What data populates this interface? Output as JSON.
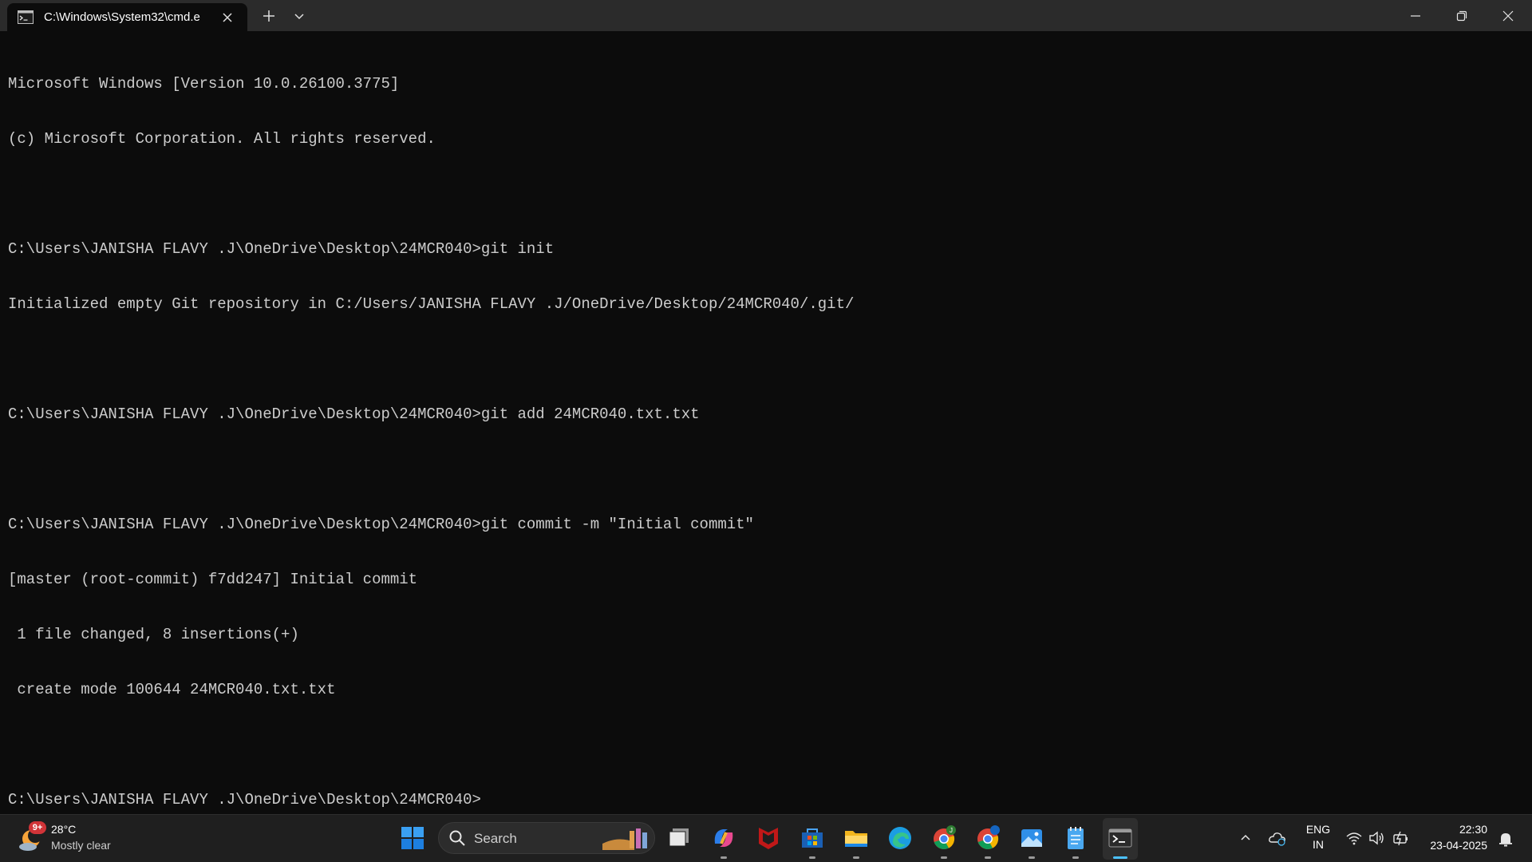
{
  "window": {
    "tab_title": "C:\\Windows\\System32\\cmd.e",
    "icons": {
      "tab": "cmd-icon",
      "close_tab": "close-icon",
      "new_tab": "plus-icon",
      "dropdown": "chevron-down-icon",
      "minimize": "minimize-icon",
      "restore": "restore-icon",
      "close": "close-icon"
    }
  },
  "console": {
    "lines": [
      "Microsoft Windows [Version 10.0.26100.3775]",
      "(c) Microsoft Corporation. All rights reserved.",
      "",
      "C:\\Users\\JANISHA FLAVY .J\\OneDrive\\Desktop\\24MCR040>git init",
      "Initialized empty Git repository in C:/Users/JANISHA FLAVY .J/OneDrive/Desktop/24MCR040/.git/",
      "",
      "C:\\Users\\JANISHA FLAVY .J\\OneDrive\\Desktop\\24MCR040>git add 24MCR040.txt.txt",
      "",
      "C:\\Users\\JANISHA FLAVY .J\\OneDrive\\Desktop\\24MCR040>git commit -m \"Initial commit\"",
      "[master (root-commit) f7dd247] Initial commit",
      " 1 file changed, 8 insertions(+)",
      " create mode 100644 24MCR040.txt.txt",
      "",
      "C:\\Users\\JANISHA FLAVY .J\\OneDrive\\Desktop\\24MCR040>"
    ],
    "colors": {
      "background": "#0c0c0c",
      "text": "#cccccc"
    }
  },
  "taskbar": {
    "weather": {
      "badge": "9+",
      "temperature": "28°C",
      "condition": "Mostly clear",
      "icon": "weather-moon-cloud-icon"
    },
    "search": {
      "placeholder": "Search"
    },
    "apps": [
      "start-icon",
      "task-view-icon",
      "copilot-icon",
      "mcafee-icon",
      "microsoft-store-icon",
      "file-explorer-icon",
      "edge-icon",
      "chrome-profile-j-icon",
      "chrome-icon",
      "photos-icon",
      "notepad-icon",
      "terminal-icon"
    ],
    "tray": {
      "language_line1": "ENG",
      "language_line2": "IN",
      "time": "22:30",
      "date": "23-04-2025"
    },
    "accent": "#4cc2ff"
  }
}
